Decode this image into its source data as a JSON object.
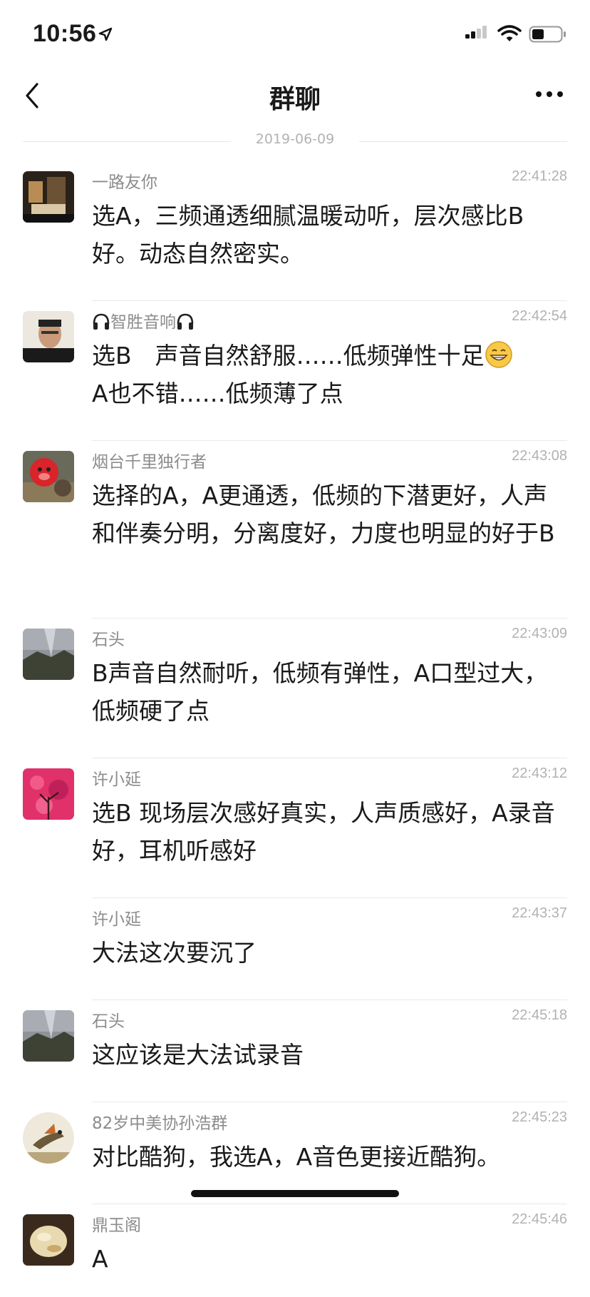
{
  "status_bar": {
    "time": "10:56"
  },
  "nav": {
    "title": "群聊"
  },
  "date_divider": "2019-06-09",
  "messages": [
    {
      "sender": "一路友你",
      "time": "22:41:28",
      "text": "选A，三频通透细腻温暖动听，层次感比B好。动态自然密实。"
    },
    {
      "sender": "智胜音响",
      "time": "22:42:54",
      "text_line1": "选B　声音自然舒服……低频弹性十足",
      "text_line2": "A也不错……低频薄了点"
    },
    {
      "sender": "烟台千里独行者",
      "time": "22:43:08",
      "text": "选择的A，A更通透，低频的下潜更好，人声和伴奏分明，分离度好，力度也明显的好于B"
    },
    {
      "sender": "石头",
      "time": "22:43:09",
      "text": "B声音自然耐听，低频有弹性，A口型过大，低频硬了点"
    },
    {
      "sender": "许小延",
      "time": "22:43:12",
      "text": "选B 现场层次感好真实，人声质感好，A录音好，耳机听感好"
    },
    {
      "sender": "许小延",
      "time": "22:43:37",
      "text": "大法这次要沉了"
    },
    {
      "sender": "石头",
      "time": "22:45:18",
      "text": "这应该是大法试录音"
    },
    {
      "sender": "82岁中美协孙浩群",
      "time": "22:45:23",
      "text": "对比酷狗，我选A，A音色更接近酷狗。"
    },
    {
      "sender": "鼎玉阁",
      "time": "22:45:46",
      "text": "A"
    }
  ]
}
